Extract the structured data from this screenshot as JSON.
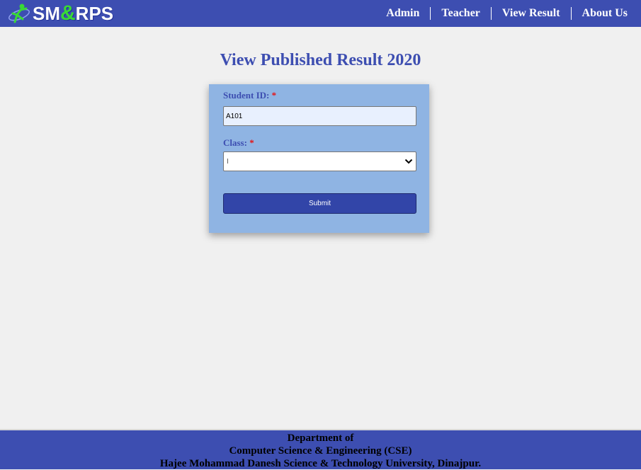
{
  "header": {
    "logo": {
      "part1": "SM",
      "amp": "&",
      "part2": "RPS"
    },
    "nav": [
      "Admin",
      "Teacher",
      "View Result",
      "About Us"
    ]
  },
  "main": {
    "title": "View Published Result 2020",
    "form": {
      "student_id_label": "Student ID:",
      "student_id_value": "A101",
      "class_label": "Class:",
      "class_selected": "I",
      "required_mark": "*",
      "submit_label": "Submit"
    }
  },
  "footer": {
    "line1": "Department of",
    "line2": "Computer Science & Engineering (CSE)",
    "line3": "Hajee Mohammad Danesh Science & Technology University, Dinajpur."
  },
  "colors": {
    "nav_bg": "#3d4eb1",
    "card_bg": "#8fb4e3",
    "button_bg": "#3245a8",
    "page_bg": "#f0f0f0",
    "logo_amp": "#39d936"
  }
}
